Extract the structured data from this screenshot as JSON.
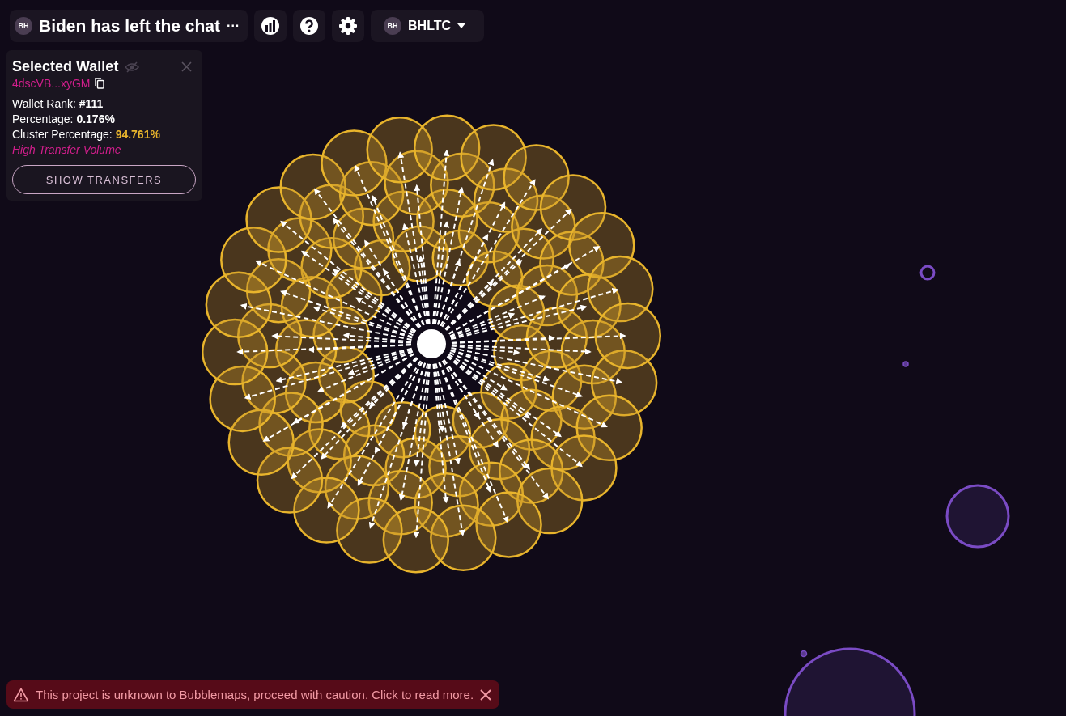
{
  "header": {
    "avatar_initials": "BH",
    "title": "Biden has left the chat",
    "more": "···"
  },
  "token_selector": {
    "avatar_initials": "BH",
    "symbol": "BHLTC"
  },
  "selected_wallet": {
    "title": "Selected Wallet",
    "address": "4dscVB...xyGM",
    "stats": [
      {
        "label": "Wallet Rank: ",
        "value": "#111",
        "kind": "plain"
      },
      {
        "label": "Percentage: ",
        "value": "0.176%",
        "kind": "plain"
      },
      {
        "label": "Cluster Percentage: ",
        "value": "94.761%",
        "kind": "highlight"
      }
    ],
    "tag": "High Transfer Volume",
    "button": "SHOW TRANSFERS"
  },
  "warning": {
    "text": "This project is unknown to Bubblemaps, proceed with caution. Click to read more."
  }
}
